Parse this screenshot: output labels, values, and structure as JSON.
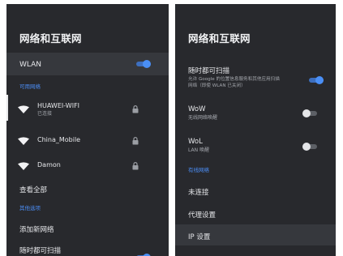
{
  "left": {
    "title": "网络和互联网",
    "wlan": {
      "label": "WLAN",
      "enabled": true
    },
    "available_networks_label": "可用网络",
    "networks": [
      {
        "name": "HUAWEI-WIFI",
        "status": "已连接",
        "locked": true
      },
      {
        "name": "China_Mobile",
        "status": "",
        "locked": true
      },
      {
        "name": "Damon",
        "status": "",
        "locked": true
      }
    ],
    "see_all": "查看全部",
    "other_options_label": "其他选项",
    "add_network": "添加新网络",
    "always_scan": "随时都可扫描"
  },
  "right": {
    "title": "网络和互联网",
    "always_scan": {
      "label": "随时都可扫描",
      "description_line1": "允许 Google 的位置信息服务和其他应用扫描",
      "description_line2": "网络（即使 WLAN 已关闭）",
      "enabled": true
    },
    "wow": {
      "label": "WoW",
      "description": "无线网络唤醒",
      "enabled": false
    },
    "wol": {
      "label": "WoL",
      "description": "LAN 唤醒",
      "enabled": false
    },
    "wired_network_label": "有线网络",
    "not_connected": "未连接",
    "proxy_settings": "代理设置",
    "ip_settings": "IP 设置"
  },
  "colors": {
    "panel_bg": "#28292d",
    "accent": "#4a8ff6",
    "text": "#e6e7ea",
    "subtext": "#a4a7ad"
  }
}
